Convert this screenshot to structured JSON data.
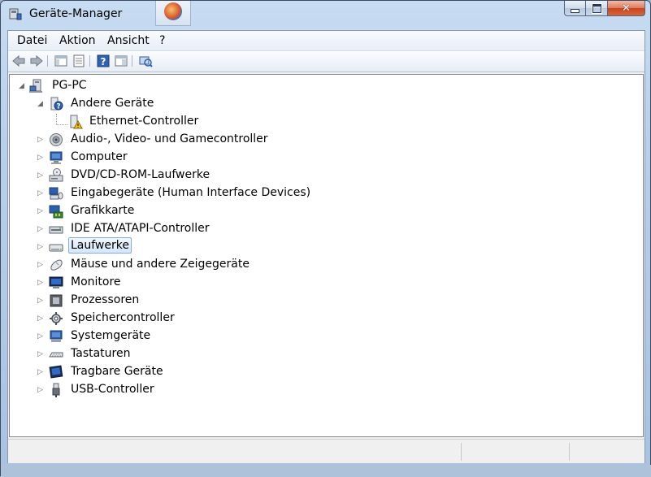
{
  "window": {
    "title": "Geräte-Manager",
    "icon": "device-manager-icon"
  },
  "caption_buttons": {
    "minimize": "minimize-icon",
    "maximize": "maximize-icon",
    "close": "✕"
  },
  "menu": {
    "items": [
      "Datei",
      "Aktion",
      "Ansicht",
      "?"
    ]
  },
  "toolbar": {
    "buttons": [
      "back-arrow-icon",
      "forward-arrow-icon",
      "console-tree-icon",
      "properties-icon",
      "help-icon",
      "view-icon",
      "scan-hardware-icon"
    ]
  },
  "tree": {
    "root": {
      "label": "PG-PC",
      "icon": "computer-icon",
      "expanded": true
    },
    "nodes": [
      {
        "label": "Andere Geräte",
        "icon": "unknown-device-icon",
        "expanded": true,
        "level": 1
      },
      {
        "label": "Ethernet-Controller",
        "icon": "warning-device-icon",
        "level": 2
      },
      {
        "label": "Audio-, Video- und Gamecontroller",
        "icon": "speaker-icon",
        "level": 1
      },
      {
        "label": "Computer",
        "icon": "computer-monitor-icon",
        "level": 1
      },
      {
        "label": "DVD/CD-ROM-Laufwerke",
        "icon": "dvd-drive-icon",
        "level": 1
      },
      {
        "label": "Eingabegeräte (Human Interface Devices)",
        "icon": "hid-icon",
        "level": 1
      },
      {
        "label": "Grafikkarte",
        "icon": "display-adapter-icon",
        "level": 1
      },
      {
        "label": "IDE ATA/ATAPI-Controller",
        "icon": "ide-controller-icon",
        "level": 1
      },
      {
        "label": "Laufwerke",
        "icon": "disk-drive-icon",
        "level": 1,
        "selected": true
      },
      {
        "label": "Mäuse und andere Zeigegeräte",
        "icon": "mouse-icon",
        "level": 1
      },
      {
        "label": "Monitore",
        "icon": "monitor-icon",
        "level": 1
      },
      {
        "label": "Prozessoren",
        "icon": "processor-icon",
        "level": 1
      },
      {
        "label": "Speichercontroller",
        "icon": "storage-controller-icon",
        "level": 1
      },
      {
        "label": "Systemgeräte",
        "icon": "system-devices-icon",
        "level": 1
      },
      {
        "label": "Tastaturen",
        "icon": "keyboard-icon",
        "level": 1
      },
      {
        "label": "Tragbare Geräte",
        "icon": "portable-device-icon",
        "level": 1
      },
      {
        "label": "USB-Controller",
        "icon": "usb-icon",
        "level": 1
      }
    ]
  },
  "colors": {
    "selection_border": "#84acdd",
    "selection_fill": "#d5e7fb",
    "window_frame": "#b9d0ea"
  }
}
